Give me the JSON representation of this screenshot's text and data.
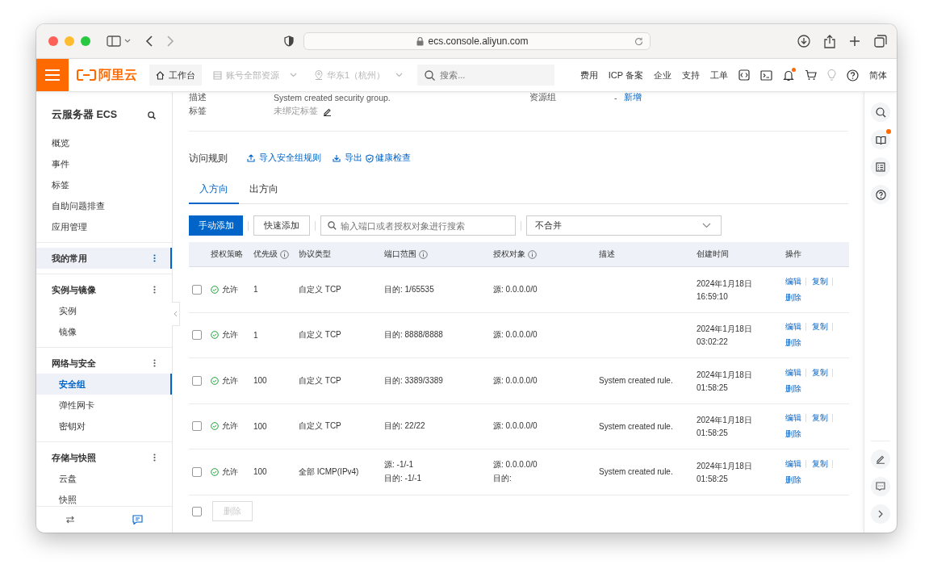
{
  "browser": {
    "url": "ecs.console.aliyun.com"
  },
  "header": {
    "logo": "阿里云",
    "nav": [
      {
        "label": "工作台",
        "kind": "home",
        "disabled": false
      },
      {
        "label": "账号全部资源",
        "kind": "resource",
        "disabled": true
      },
      {
        "label": "华东1（杭州）",
        "kind": "region",
        "disabled": true
      }
    ],
    "search": {
      "placeholder": "搜索..."
    },
    "links": [
      "费用",
      "ICP 备案",
      "企业",
      "支持",
      "工单"
    ],
    "bell_badge": true,
    "language": "简体"
  },
  "sidebar": {
    "title": "云服务器 ECS",
    "items": [
      "概览",
      "事件",
      "标签",
      "自助问题排查",
      "应用管理"
    ],
    "groups": [
      {
        "label": "我的常用",
        "selected": true
      },
      {
        "label": "实例与镜像",
        "selected": false,
        "children": [
          {
            "label": "实例",
            "selected": false
          },
          {
            "label": "镜像",
            "selected": false
          }
        ]
      },
      {
        "label": "网络与安全",
        "selected": false,
        "children": [
          {
            "label": "安全组",
            "selected": true
          },
          {
            "label": "弹性网卡",
            "selected": false
          },
          {
            "label": "密钥对",
            "selected": false
          }
        ]
      },
      {
        "label": "存储与快照",
        "selected": false,
        "children": [
          {
            "label": "云盘",
            "selected": false
          },
          {
            "label": "快照",
            "selected": false
          }
        ]
      }
    ]
  },
  "details": [
    {
      "label": "描述",
      "value": "System created security group."
    },
    {
      "label": "标签",
      "value": "未绑定标签"
    }
  ],
  "resource_group": {
    "label": "资源组",
    "value": "-",
    "link": "新增"
  },
  "rules": {
    "title": "访问规则",
    "actions": [
      {
        "label": "导入安全组规则",
        "kind": "import"
      },
      {
        "label": "导出",
        "kind": "export"
      },
      {
        "label": "健康检查",
        "kind": "check"
      }
    ],
    "tabs": [
      {
        "label": "入方向",
        "selected": true
      },
      {
        "label": "出方向",
        "selected": false
      }
    ],
    "add_button": "手动添加",
    "quick_add_button": "快速添加",
    "search": {
      "placeholder": "输入端口或者授权对象进行搜索"
    },
    "merge_select": {
      "value": "不合并"
    }
  },
  "table": {
    "columns": [
      {
        "label": "授权策略",
        "info": false
      },
      {
        "label": "优先级",
        "info": true
      },
      {
        "label": "协议类型",
        "info": false
      },
      {
        "label": "端口范围",
        "info": true
      },
      {
        "label": "授权对象",
        "info": true
      },
      {
        "label": "描述",
        "info": false
      },
      {
        "label": "创建时间",
        "info": false
      },
      {
        "label": "操作",
        "info": false
      }
    ],
    "rows": [
      {
        "checked": false,
        "policy": "允许",
        "priority": "1",
        "protocol": "自定义 TCP",
        "port": [
          "目的: 1/65535"
        ],
        "object": [
          "源: 0.0.0.0/0"
        ],
        "created": [
          "2024年1月18日",
          "16:59:10"
        ],
        "actions": [
          "编辑",
          "复制",
          "删除"
        ]
      },
      {
        "checked": false,
        "policy": "允许",
        "priority": "1",
        "protocol": "自定义 TCP",
        "port": [
          "目的: 8888/8888"
        ],
        "object": [
          "源: 0.0.0.0/0"
        ],
        "created": [
          "2024年1月18日",
          "03:02:22"
        ],
        "actions": [
          "编辑",
          "复制",
          "删除"
        ]
      },
      {
        "checked": false,
        "policy": "允许",
        "priority": "100",
        "protocol": "自定义 TCP",
        "port": [
          "目的: 3389/3389"
        ],
        "object": [
          "源: 0.0.0.0/0"
        ],
        "description": "System created rule.",
        "created": [
          "2024年1月18日",
          "01:58:25"
        ],
        "actions": [
          "编辑",
          "复制",
          "删除"
        ]
      },
      {
        "checked": false,
        "policy": "允许",
        "priority": "100",
        "protocol": "自定义 TCP",
        "port": [
          "目的: 22/22"
        ],
        "object": [
          "源: 0.0.0.0/0"
        ],
        "description": "System created rule.",
        "created": [
          "2024年1月18日",
          "01:58:25"
        ],
        "actions": [
          "编辑",
          "复制",
          "删除"
        ]
      },
      {
        "checked": false,
        "policy": "允许",
        "priority": "100",
        "protocol": "全部 ICMP(IPv4)",
        "port": [
          "源: -1/-1",
          "目的: -1/-1"
        ],
        "object": [
          "源: 0.0.0.0/0",
          "目的:"
        ],
        "description": "System created rule.",
        "created": [
          "2024年1月18日",
          "01:58:25"
        ],
        "actions": [
          "编辑",
          "复制",
          "删除"
        ]
      }
    ],
    "footer": {
      "checked": false,
      "delete_button": {
        "label": "删除",
        "disabled": true
      }
    }
  },
  "rail": {
    "book_badge": true
  }
}
